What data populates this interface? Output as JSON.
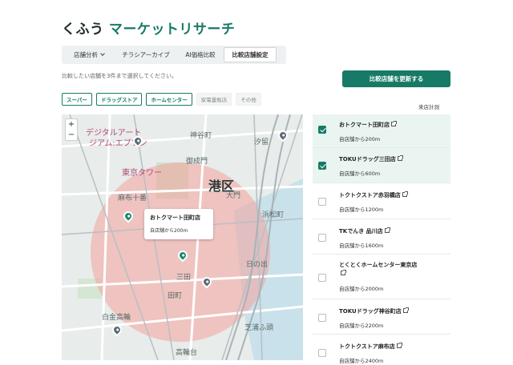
{
  "app": {
    "title_part1": "くふう",
    "title_part2": "マーケットリサーチ"
  },
  "tabs": [
    {
      "label": "店舗分析",
      "active": false,
      "has_dropdown": true
    },
    {
      "label": "チラシアーカイブ",
      "active": false
    },
    {
      "label": "AI価格比較",
      "active": false
    },
    {
      "label": "比較店舗設定",
      "active": true
    }
  ],
  "instruction": "比較したい店舗を3件まで選択してください。",
  "update_button": "比較店舗を更新する",
  "filters": [
    {
      "label": "スーパー",
      "selected": true
    },
    {
      "label": "ドラッグストア",
      "selected": true
    },
    {
      "label": "ホームセンター",
      "selected": true
    },
    {
      "label": "家電量販店",
      "selected": false
    },
    {
      "label": "その他",
      "selected": false
    }
  ],
  "list_header": "来店計測",
  "map": {
    "zoom_in": "+",
    "zoom_out": "−",
    "labels": {
      "district": "港区",
      "tower": "東京タワー",
      "museum": "デジタルアート",
      "museum2": "ジアム:エプソン",
      "kamiyacho": "神谷町",
      "onarimon": "御成門",
      "daimon": "大門",
      "azabu_juban": "麻布十番",
      "shiodome": "汐留",
      "hamamatsucho": "浜松町",
      "mita": "三田",
      "tamachi": "田町",
      "hinode": "日の出",
      "shibaura": "芝浦ふ頭",
      "shirokane": "白金高輪",
      "takanawa": "高輪台"
    },
    "popup": {
      "name": "おトクマート田町店",
      "distance": "自店舗から200m"
    },
    "radius_color": "#f4a39a",
    "accent": "#177a66"
  },
  "stores": [
    {
      "name": "おトクマート田町店",
      "distance": "自店舗から200m",
      "checked": true
    },
    {
      "name": "TOKUドラッグ三田店",
      "distance": "自店舗から600m",
      "checked": true
    },
    {
      "name": "トクトクストア赤羽橋店",
      "distance": "自店舗から1200m",
      "checked": false
    },
    {
      "name": "TKでんき 品川店",
      "distance": "自店舗から1600m",
      "checked": false
    },
    {
      "name": "とくとくホームセンター東京店",
      "distance": "自店舗から2000m",
      "checked": false
    },
    {
      "name": "TOKUドラッグ神谷町店",
      "distance": "自店舗から2200m",
      "checked": false
    },
    {
      "name": "トクトクストア麻布店",
      "distance": "自店舗から2400m",
      "checked": false
    }
  ]
}
